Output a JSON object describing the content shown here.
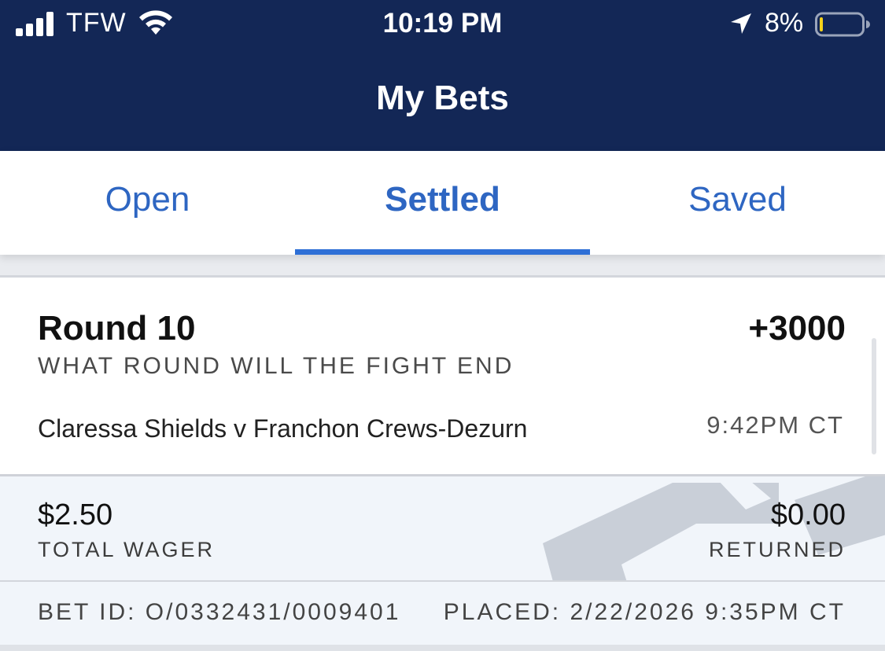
{
  "status_bar": {
    "carrier": "TFW",
    "time": "10:19 PM",
    "battery_percent": "8%",
    "battery_level": 0.08,
    "icons": [
      "signal-icon",
      "wifi-icon",
      "location-arrow-icon",
      "battery-icon"
    ]
  },
  "header": {
    "title": "My Bets",
    "background_color": "#132756"
  },
  "tabs": [
    {
      "label": "Open",
      "active": false
    },
    {
      "label": "Settled",
      "active": true
    },
    {
      "label": "Saved",
      "active": false
    }
  ],
  "accent_color": "#2e6fd6",
  "bet": {
    "selection": "Round 10",
    "odds": "+3000",
    "market": "WHAT ROUND WILL THE FIGHT END",
    "event": "Claressa Shields v Franchon Crews-Dezurn",
    "event_time": "9:42PM CT",
    "total_wager": "$2.50",
    "total_wager_label": "TOTAL WAGER",
    "returned": "$0.00",
    "returned_label": "RETURNED",
    "bet_id": "BET ID: O/0332431/0009401",
    "placed": "PLACED: 2/22/2026 9:35PM CT"
  }
}
